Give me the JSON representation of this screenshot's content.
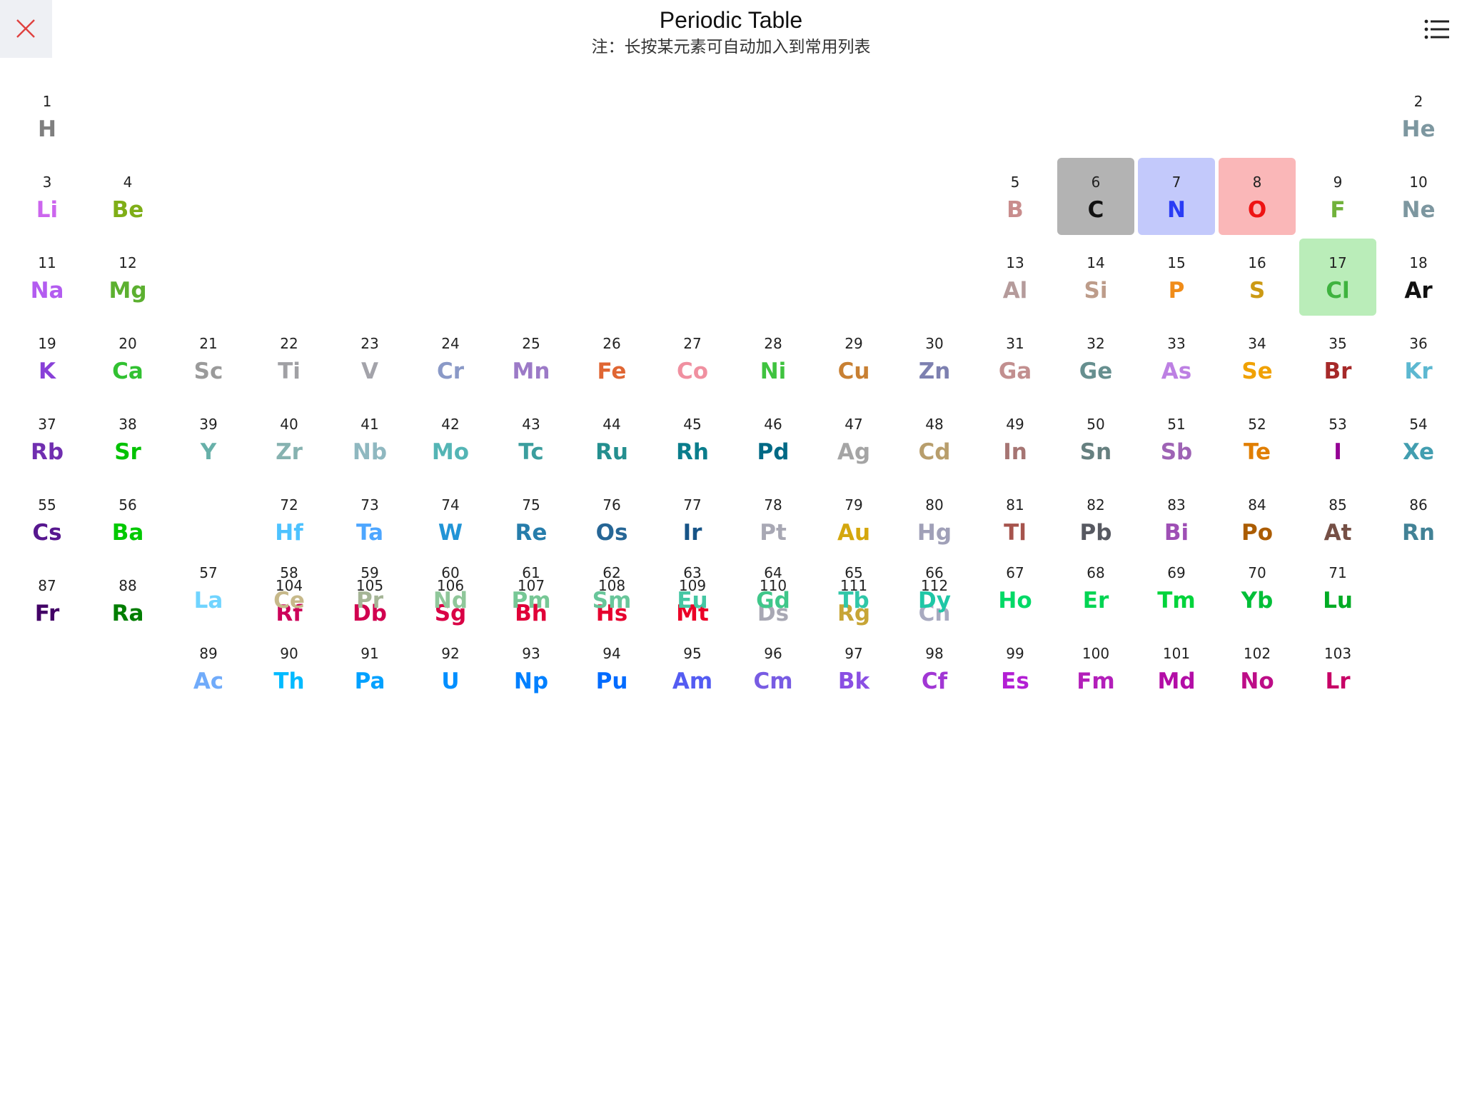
{
  "header": {
    "title": "Periodic Table",
    "note": "注：长按某元素可自动加入到常用列表"
  },
  "icons": {
    "close": "close-icon",
    "menu": "list-menu-icon"
  },
  "colors": {
    "close_icon": "#e0413f",
    "close_bg": "#eef0f4"
  },
  "elements": [
    {
      "n": "1",
      "s": "H",
      "c": "#7f7f7f",
      "r": 1,
      "g": 1
    },
    {
      "n": "2",
      "s": "He",
      "c": "#7d97a0",
      "r": 1,
      "g": 18
    },
    {
      "n": "3",
      "s": "Li",
      "c": "#cc66ee",
      "r": 2,
      "g": 1
    },
    {
      "n": "4",
      "s": "Be",
      "c": "#7fae17",
      "r": 2,
      "g": 2
    },
    {
      "n": "5",
      "s": "B",
      "c": "#c98d8d",
      "r": 2,
      "g": 13
    },
    {
      "n": "6",
      "s": "C",
      "c": "#111111",
      "r": 2,
      "g": 14,
      "bg": "#b3b3b3"
    },
    {
      "n": "7",
      "s": "N",
      "c": "#2a3cf5",
      "r": 2,
      "g": 15,
      "bg": "#c3c9fb"
    },
    {
      "n": "8",
      "s": "O",
      "c": "#ee1313",
      "r": 2,
      "g": 16,
      "bg": "#fab7b8"
    },
    {
      "n": "9",
      "s": "F",
      "c": "#71b23b",
      "r": 2,
      "g": 17
    },
    {
      "n": "10",
      "s": "Ne",
      "c": "#7d97a0",
      "r": 2,
      "g": 18
    },
    {
      "n": "11",
      "s": "Na",
      "c": "#b35cf0",
      "r": 3,
      "g": 1
    },
    {
      "n": "12",
      "s": "Mg",
      "c": "#5cb030",
      "r": 3,
      "g": 2
    },
    {
      "n": "13",
      "s": "Al",
      "c": "#b59b9b",
      "r": 3,
      "g": 13
    },
    {
      "n": "14",
      "s": "Si",
      "c": "#bd9c8a",
      "r": 3,
      "g": 14
    },
    {
      "n": "15",
      "s": "P",
      "c": "#f08c19",
      "r": 3,
      "g": 15
    },
    {
      "n": "16",
      "s": "S",
      "c": "#cc9a14",
      "r": 3,
      "g": 16
    },
    {
      "n": "17",
      "s": "Cl",
      "c": "#3fb33f",
      "r": 3,
      "g": 17,
      "bg": "#baedb9"
    },
    {
      "n": "18",
      "s": "Ar",
      "c": "#111111",
      "r": 3,
      "g": 18
    },
    {
      "n": "19",
      "s": "K",
      "c": "#8840d8",
      "r": 4,
      "g": 1
    },
    {
      "n": "20",
      "s": "Ca",
      "c": "#31c131",
      "r": 4,
      "g": 2
    },
    {
      "n": "21",
      "s": "Sc",
      "c": "#9a9a9a",
      "r": 4,
      "g": 3
    },
    {
      "n": "22",
      "s": "Ti",
      "c": "#a0a0a4",
      "r": 4,
      "g": 4
    },
    {
      "n": "23",
      "s": "V",
      "c": "#a3a3aa",
      "r": 4,
      "g": 5
    },
    {
      "n": "24",
      "s": "Cr",
      "c": "#8a99c7",
      "r": 4,
      "g": 6
    },
    {
      "n": "25",
      "s": "Mn",
      "c": "#9c7ac7",
      "r": 4,
      "g": 7
    },
    {
      "n": "26",
      "s": "Fe",
      "c": "#e06633",
      "r": 4,
      "g": 8
    },
    {
      "n": "27",
      "s": "Co",
      "c": "#f090a0",
      "r": 4,
      "g": 9
    },
    {
      "n": "28",
      "s": "Ni",
      "c": "#3fc33f",
      "r": 4,
      "g": 10
    },
    {
      "n": "29",
      "s": "Cu",
      "c": "#c88033",
      "r": 4,
      "g": 11
    },
    {
      "n": "30",
      "s": "Zn",
      "c": "#7d80b0",
      "r": 4,
      "g": 12
    },
    {
      "n": "31",
      "s": "Ga",
      "c": "#c28f8f",
      "r": 4,
      "g": 13
    },
    {
      "n": "32",
      "s": "Ge",
      "c": "#668f8f",
      "r": 4,
      "g": 14
    },
    {
      "n": "33",
      "s": "As",
      "c": "#bd80e3",
      "r": 4,
      "g": 15
    },
    {
      "n": "34",
      "s": "Se",
      "c": "#f0a100",
      "r": 4,
      "g": 16
    },
    {
      "n": "35",
      "s": "Br",
      "c": "#a62929",
      "r": 4,
      "g": 17
    },
    {
      "n": "36",
      "s": "Kr",
      "c": "#5cb8d1",
      "r": 4,
      "g": 18
    },
    {
      "n": "37",
      "s": "Rb",
      "c": "#702eb0",
      "r": 5,
      "g": 1
    },
    {
      "n": "38",
      "s": "Sr",
      "c": "#00c200",
      "r": 5,
      "g": 2
    },
    {
      "n": "39",
      "s": "Y",
      "c": "#67b0a9",
      "r": 5,
      "g": 3
    },
    {
      "n": "40",
      "s": "Zr",
      "c": "#86b2b0",
      "r": 5,
      "g": 4
    },
    {
      "n": "41",
      "s": "Nb",
      "c": "#8fb8c0",
      "r": 5,
      "g": 5
    },
    {
      "n": "42",
      "s": "Mo",
      "c": "#54b5b5",
      "r": 5,
      "g": 6
    },
    {
      "n": "43",
      "s": "Tc",
      "c": "#3b9e9e",
      "r": 5,
      "g": 7
    },
    {
      "n": "44",
      "s": "Ru",
      "c": "#248f8f",
      "r": 5,
      "g": 8
    },
    {
      "n": "45",
      "s": "Rh",
      "c": "#0a7d8c",
      "r": 5,
      "g": 9
    },
    {
      "n": "46",
      "s": "Pd",
      "c": "#006985",
      "r": 5,
      "g": 10
    },
    {
      "n": "47",
      "s": "Ag",
      "c": "#a5a5a5",
      "r": 5,
      "g": 11
    },
    {
      "n": "48",
      "s": "Cd",
      "c": "#b89e6c",
      "r": 5,
      "g": 12
    },
    {
      "n": "49",
      "s": "In",
      "c": "#a67573",
      "r": 5,
      "g": 13
    },
    {
      "n": "50",
      "s": "Sn",
      "c": "#668080",
      "r": 5,
      "g": 14
    },
    {
      "n": "51",
      "s": "Sb",
      "c": "#9e63b5",
      "r": 5,
      "g": 15
    },
    {
      "n": "52",
      "s": "Te",
      "c": "#e07e00",
      "r": 5,
      "g": 16
    },
    {
      "n": "53",
      "s": "I",
      "c": "#940094",
      "r": 5,
      "g": 17
    },
    {
      "n": "54",
      "s": "Xe",
      "c": "#429eb0",
      "r": 5,
      "g": 18
    },
    {
      "n": "55",
      "s": "Cs",
      "c": "#57178f",
      "r": 6,
      "g": 1
    },
    {
      "n": "56",
      "s": "Ba",
      "c": "#00c900",
      "r": 6,
      "g": 2
    },
    {
      "n": "72",
      "s": "Hf",
      "c": "#4dc2ff",
      "r": 6,
      "g": 4
    },
    {
      "n": "73",
      "s": "Ta",
      "c": "#4da6ff",
      "r": 6,
      "g": 5
    },
    {
      "n": "74",
      "s": "W",
      "c": "#2194d6",
      "r": 6,
      "g": 6
    },
    {
      "n": "75",
      "s": "Re",
      "c": "#267dab",
      "r": 6,
      "g": 7
    },
    {
      "n": "76",
      "s": "Os",
      "c": "#266696",
      "r": 6,
      "g": 8
    },
    {
      "n": "77",
      "s": "Ir",
      "c": "#175487",
      "r": 6,
      "g": 9
    },
    {
      "n": "78",
      "s": "Pt",
      "c": "#a8a8b4",
      "r": 6,
      "g": 10
    },
    {
      "n": "79",
      "s": "Au",
      "c": "#d4a70d",
      "r": 6,
      "g": 11
    },
    {
      "n": "80",
      "s": "Hg",
      "c": "#a0a0b8",
      "r": 6,
      "g": 12
    },
    {
      "n": "81",
      "s": "Tl",
      "c": "#a6544d",
      "r": 6,
      "g": 13
    },
    {
      "n": "82",
      "s": "Pb",
      "c": "#575961",
      "r": 6,
      "g": 14
    },
    {
      "n": "83",
      "s": "Bi",
      "c": "#9e4fb5",
      "r": 6,
      "g": 15
    },
    {
      "n": "84",
      "s": "Po",
      "c": "#ab5c00",
      "r": 6,
      "g": 16
    },
    {
      "n": "85",
      "s": "At",
      "c": "#754f45",
      "r": 6,
      "g": 17
    },
    {
      "n": "86",
      "s": "Rn",
      "c": "#428296",
      "r": 6,
      "g": 18
    },
    {
      "n": "87",
      "s": "Fr",
      "c": "#420066",
      "r": 7,
      "g": 1
    },
    {
      "n": "88",
      "s": "Ra",
      "c": "#007d00",
      "r": 7,
      "g": 2
    },
    {
      "n": "104",
      "s": "Rf",
      "c": "#cc0059",
      "r": 7,
      "g": 4
    },
    {
      "n": "105",
      "s": "Db",
      "c": "#d1004f",
      "r": 7,
      "g": 5
    },
    {
      "n": "106",
      "s": "Sg",
      "c": "#d90045",
      "r": 7,
      "g": 6
    },
    {
      "n": "107",
      "s": "Bh",
      "c": "#e00038",
      "r": 7,
      "g": 7
    },
    {
      "n": "108",
      "s": "Hs",
      "c": "#e6002e",
      "r": 7,
      "g": 8
    },
    {
      "n": "109",
      "s": "Mt",
      "c": "#eb0026",
      "r": 7,
      "g": 9
    },
    {
      "n": "110",
      "s": "Ds",
      "c": "#a8a8b4",
      "r": 7,
      "g": 10
    },
    {
      "n": "111",
      "s": "Rg",
      "c": "#c7a536",
      "r": 7,
      "g": 11
    },
    {
      "n": "112",
      "s": "Cn",
      "c": "#a8aac0",
      "r": 7,
      "g": 12
    },
    {
      "n": "57",
      "s": "La",
      "c": "#70d4ff",
      "r": 8,
      "g": 3
    },
    {
      "n": "58",
      "s": "Ce",
      "c": "#c7b98a",
      "r": 8,
      "g": 4
    },
    {
      "n": "59",
      "s": "Pr",
      "c": "#a5b596",
      "r": 8,
      "g": 5
    },
    {
      "n": "60",
      "s": "Nd",
      "c": "#8fc79a",
      "r": 8,
      "g": 6
    },
    {
      "n": "61",
      "s": "Pm",
      "c": "#76c795",
      "r": 8,
      "g": 7
    },
    {
      "n": "62",
      "s": "Sm",
      "c": "#68c69a",
      "r": 8,
      "g": 8
    },
    {
      "n": "63",
      "s": "Eu",
      "c": "#45c7a3",
      "r": 8,
      "g": 9
    },
    {
      "n": "64",
      "s": "Gd",
      "c": "#40c78a",
      "r": 8,
      "g": 10
    },
    {
      "n": "65",
      "s": "Tb",
      "c": "#30c7a8",
      "r": 8,
      "g": 11
    },
    {
      "n": "66",
      "s": "Dy",
      "c": "#1fc7a6",
      "r": 8,
      "g": 12
    },
    {
      "n": "67",
      "s": "Ho",
      "c": "#00d966",
      "r": 8,
      "g": 13
    },
    {
      "n": "68",
      "s": "Er",
      "c": "#00d452",
      "r": 8,
      "g": 14
    },
    {
      "n": "69",
      "s": "Tm",
      "c": "#00d43b",
      "r": 8,
      "g": 15
    },
    {
      "n": "70",
      "s": "Yb",
      "c": "#00bf38",
      "r": 8,
      "g": 16
    },
    {
      "n": "71",
      "s": "Lu",
      "c": "#00ab24",
      "r": 8,
      "g": 17
    },
    {
      "n": "89",
      "s": "Ac",
      "c": "#70abfa",
      "r": 9,
      "g": 3
    },
    {
      "n": "90",
      "s": "Th",
      "c": "#00baff",
      "r": 9,
      "g": 4
    },
    {
      "n": "91",
      "s": "Pa",
      "c": "#00a1ff",
      "r": 9,
      "g": 5
    },
    {
      "n": "92",
      "s": "U",
      "c": "#008fff",
      "r": 9,
      "g": 6
    },
    {
      "n": "93",
      "s": "Np",
      "c": "#0080ff",
      "r": 9,
      "g": 7
    },
    {
      "n": "94",
      "s": "Pu",
      "c": "#006bff",
      "r": 9,
      "g": 8
    },
    {
      "n": "95",
      "s": "Am",
      "c": "#545cf2",
      "r": 9,
      "g": 9
    },
    {
      "n": "96",
      "s": "Cm",
      "c": "#785ce3",
      "r": 9,
      "g": 10
    },
    {
      "n": "97",
      "s": "Bk",
      "c": "#8a4fe3",
      "r": 9,
      "g": 11
    },
    {
      "n": "98",
      "s": "Cf",
      "c": "#a136d4",
      "r": 9,
      "g": 12
    },
    {
      "n": "99",
      "s": "Es",
      "c": "#b31fd4",
      "r": 9,
      "g": 13
    },
    {
      "n": "100",
      "s": "Fm",
      "c": "#b31fba",
      "r": 9,
      "g": 14
    },
    {
      "n": "101",
      "s": "Md",
      "c": "#b30da6",
      "r": 9,
      "g": 15
    },
    {
      "n": "102",
      "s": "No",
      "c": "#bd0d87",
      "r": 9,
      "g": 16
    },
    {
      "n": "103",
      "s": "Lr",
      "c": "#c70066",
      "r": 9,
      "g": 17
    }
  ]
}
